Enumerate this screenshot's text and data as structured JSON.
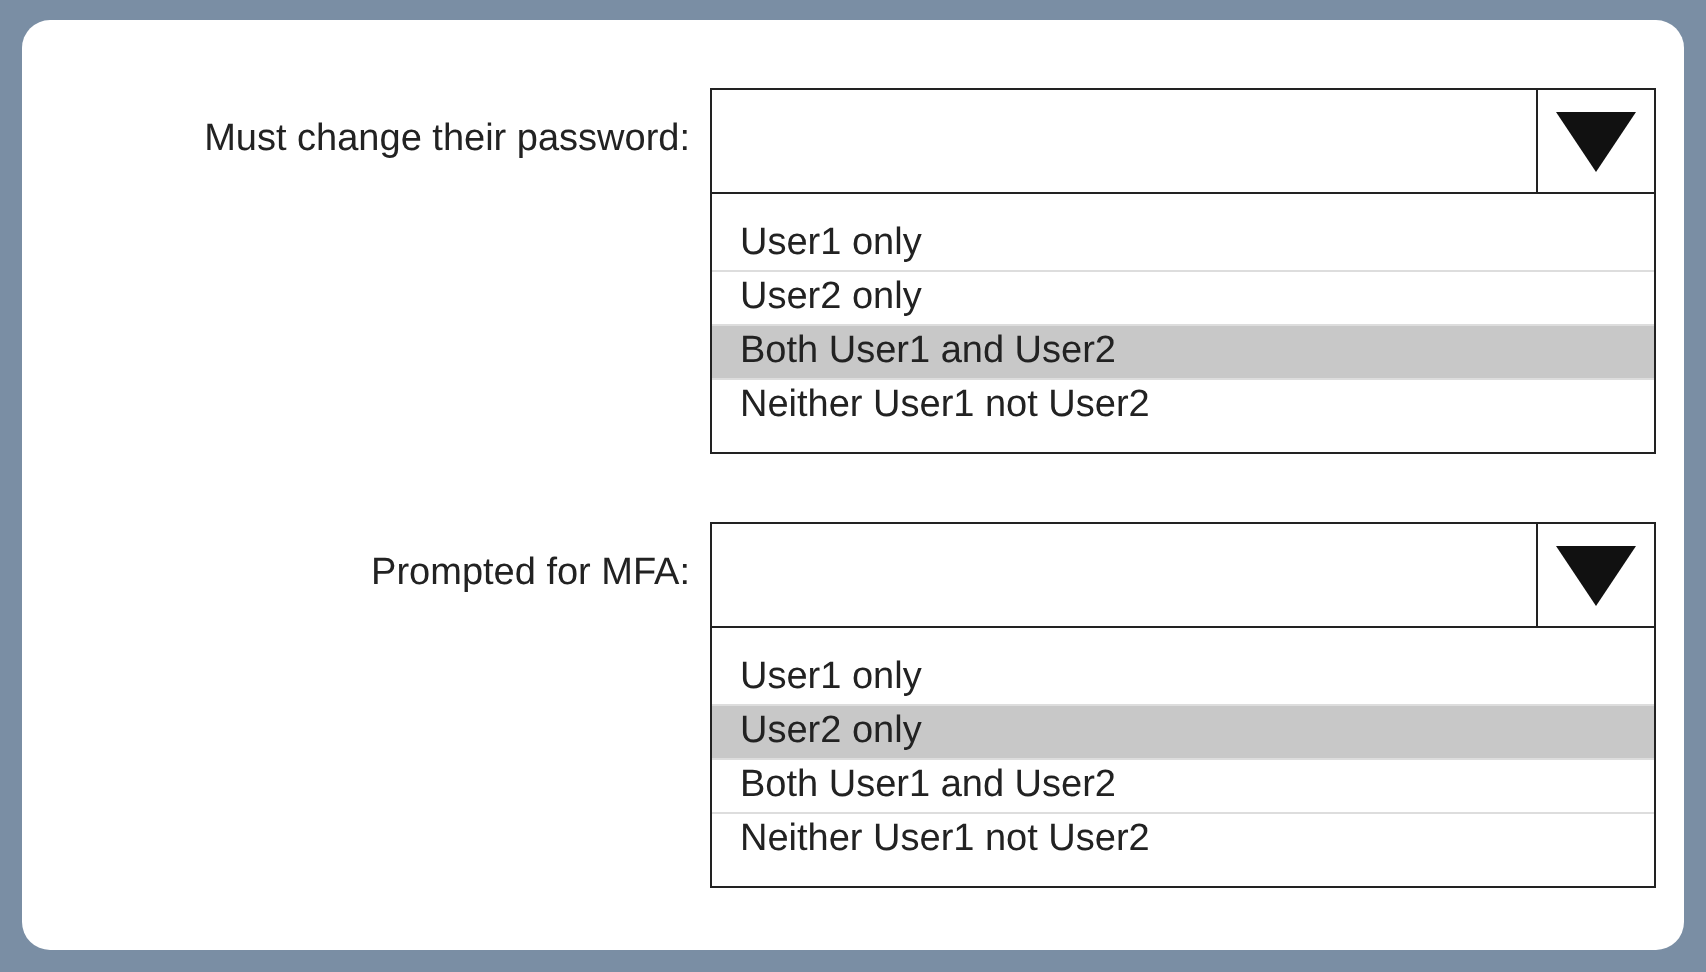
{
  "dropdowns": [
    {
      "label": "Must change their password:",
      "options": [
        {
          "text": "User1 only",
          "selected": false
        },
        {
          "text": "User2 only",
          "selected": false
        },
        {
          "text": "Both User1 and User2",
          "selected": true
        },
        {
          "text": "Neither User1 not User2",
          "selected": false
        }
      ]
    },
    {
      "label": "Prompted for MFA:",
      "options": [
        {
          "text": "User1 only",
          "selected": false
        },
        {
          "text": "User2 only",
          "selected": true
        },
        {
          "text": "Both User1 and User2",
          "selected": false
        },
        {
          "text": "Neither User1 not User2",
          "selected": false
        }
      ]
    }
  ]
}
